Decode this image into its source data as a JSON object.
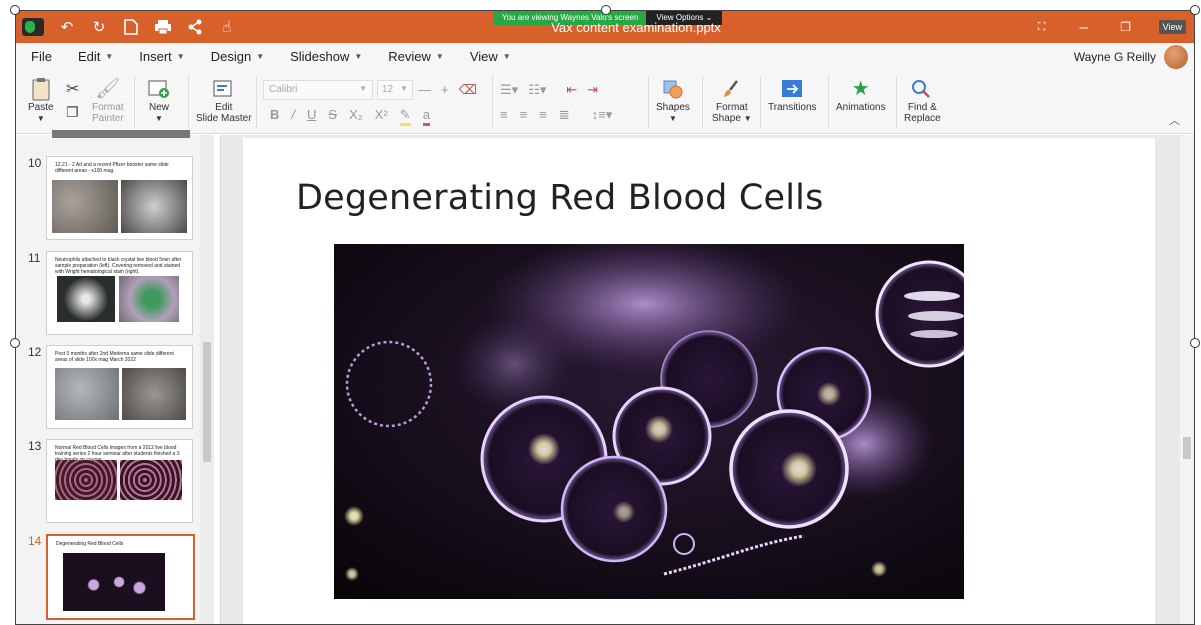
{
  "window": {
    "doc_title": "Vax content examination.pptx",
    "share_banner": "You are viewing Waynes Valo's screen",
    "view_options": "View Options",
    "view_button": "View"
  },
  "menu": {
    "items": [
      "File",
      "Edit",
      "Insert",
      "Design",
      "Slideshow",
      "Review",
      "View"
    ],
    "user_name": "Wayne G Reilly"
  },
  "ribbon": {
    "paste": "Paste",
    "format_painter_1": "Format",
    "format_painter_2": "Painter",
    "new": "New",
    "edit_master_1": "Edit",
    "edit_master_2": "Slide Master",
    "font_name": "Calibri",
    "font_size": "12",
    "shapes": "Shapes",
    "format_shape_1": "Format",
    "format_shape_2": "Shape",
    "transitions": "Transitions",
    "animations": "Animations",
    "find_replace_1": "Find &",
    "find_replace_2": "Replace"
  },
  "slides": [
    {
      "num": "10",
      "title": "12.21 - 2 Ad and a recent Pfizer booster same slide different areas - x100 mag."
    },
    {
      "num": "11",
      "title": "Neutrophils attached to black crystal live blood 5min after sample preparation (left). Covering removed and stained with Wright hematological stain (right)."
    },
    {
      "num": "12",
      "title": "Post 3 months after 2nd Moderna same slide different areas of slide 100x mag March 2022"
    },
    {
      "num": "13",
      "title": "Normal Red Blood Cells images from a 2012 live blood training series 2 hour seminar after students finished a 3 day hands on course"
    },
    {
      "num": "14",
      "title": "Degenerating Red Blood Cells"
    }
  ],
  "current_slide": {
    "title": "Degenerating Red Blood Cells"
  },
  "colors": {
    "accent": "#d8602a",
    "banner_green": "#27a844"
  }
}
